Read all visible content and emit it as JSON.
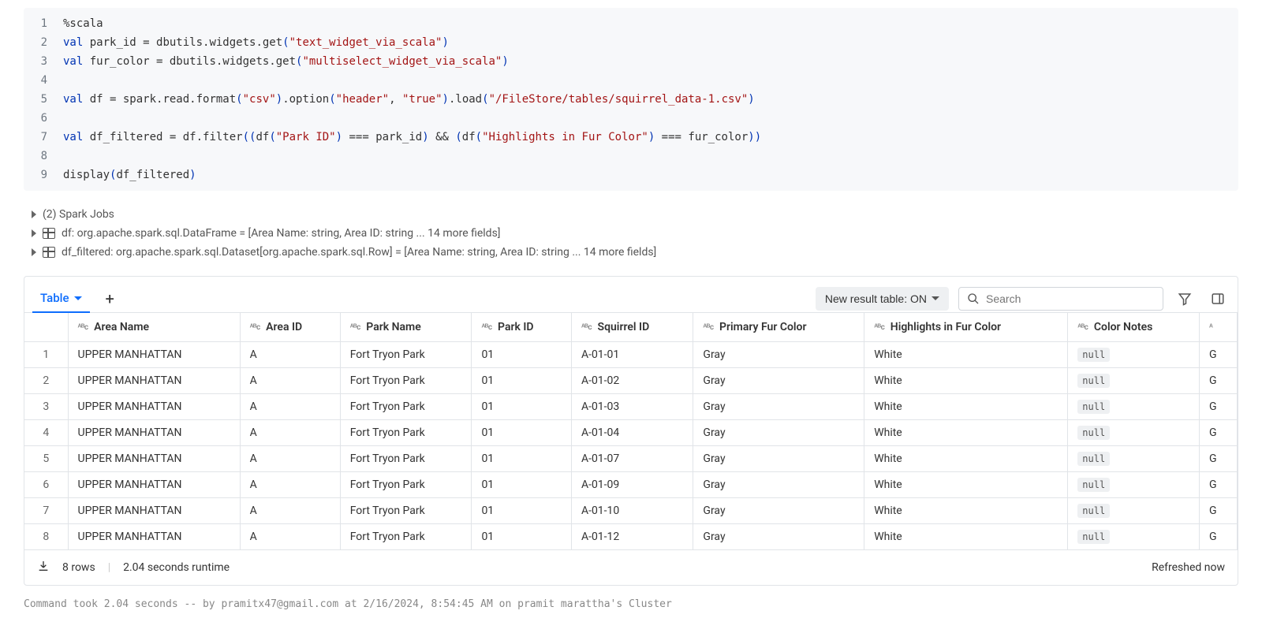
{
  "code": {
    "lines": [
      {
        "n": "1",
        "html": "<span class='tok-magic'>%scala</span>"
      },
      {
        "n": "2",
        "html": "<span class='tok-kw'>val</span> park_id = dbutils.widgets.get<span class='tok-paren'>(</span><span class='tok-str'>\"text_widget_via_scala\"</span><span class='tok-paren'>)</span>"
      },
      {
        "n": "3",
        "html": "<span class='tok-kw'>val</span> fur_color = dbutils.widgets.get<span class='tok-paren'>(</span><span class='tok-str'>\"multiselect_widget_via_scala\"</span><span class='tok-paren'>)</span>"
      },
      {
        "n": "4",
        "html": ""
      },
      {
        "n": "5",
        "html": "<span class='tok-kw'>val</span> df = spark.read.format<span class='tok-paren'>(</span><span class='tok-str'>\"csv\"</span><span class='tok-paren'>)</span>.option<span class='tok-paren'>(</span><span class='tok-str'>\"header\"</span>, <span class='tok-str'>\"true\"</span><span class='tok-paren'>)</span>.load<span class='tok-paren'>(</span><span class='tok-str'>\"/FileStore/tables/squirrel_data-1.csv\"</span><span class='tok-paren'>)</span>"
      },
      {
        "n": "6",
        "html": ""
      },
      {
        "n": "7",
        "html": "<span class='tok-kw'>val</span> df_filtered = df.filter<span class='tok-paren'>((</span>df<span class='tok-paren'>(</span><span class='tok-str'>\"Park ID\"</span><span class='tok-paren'>)</span> === park_id<span class='tok-paren'>)</span> &amp;&amp; <span class='tok-paren'>(</span>df<span class='tok-paren'>(</span><span class='tok-str'>\"Highlights in Fur Color\"</span><span class='tok-paren'>)</span> === fur_color<span class='tok-paren'>))</span>"
      },
      {
        "n": "8",
        "html": ""
      },
      {
        "n": "9",
        "html": "display<span class='tok-paren'>(</span>df_filtered<span class='tok-paren'>)</span>"
      }
    ]
  },
  "output": {
    "spark_jobs": "(2) Spark Jobs",
    "df_line": "df:  org.apache.spark.sql.DataFrame = [Area Name: string, Area ID: string ... 14 more fields]",
    "df_filtered_line": "df_filtered:  org.apache.spark.sql.Dataset[org.apache.spark.sql.Row] = [Area Name: string, Area ID: string ... 14 more fields]"
  },
  "toolbar": {
    "tab_label": "Table",
    "new_result_label": "New result table: ON",
    "search_placeholder": "Search"
  },
  "table": {
    "type_abc": "ᴬᴮc",
    "columns": [
      "Area Name",
      "Area ID",
      "Park Name",
      "Park ID",
      "Squirrel ID",
      "Primary Fur Color",
      "Highlights in Fur Color",
      "Color Notes"
    ],
    "rows": [
      {
        "n": "1",
        "area_name": "UPPER MANHATTAN",
        "area_id": "A",
        "park_name": "Fort Tryon Park",
        "park_id": "01",
        "squirrel_id": "A-01-01",
        "primary": "Gray",
        "highlights": "White",
        "notes": "null",
        "extra": "G"
      },
      {
        "n": "2",
        "area_name": "UPPER MANHATTAN",
        "area_id": "A",
        "park_name": "Fort Tryon Park",
        "park_id": "01",
        "squirrel_id": "A-01-02",
        "primary": "Gray",
        "highlights": "White",
        "notes": "null",
        "extra": "G"
      },
      {
        "n": "3",
        "area_name": "UPPER MANHATTAN",
        "area_id": "A",
        "park_name": "Fort Tryon Park",
        "park_id": "01",
        "squirrel_id": "A-01-03",
        "primary": "Gray",
        "highlights": "White",
        "notes": "null",
        "extra": "G"
      },
      {
        "n": "4",
        "area_name": "UPPER MANHATTAN",
        "area_id": "A",
        "park_name": "Fort Tryon Park",
        "park_id": "01",
        "squirrel_id": "A-01-04",
        "primary": "Gray",
        "highlights": "White",
        "notes": "null",
        "extra": "G"
      },
      {
        "n": "5",
        "area_name": "UPPER MANHATTAN",
        "area_id": "A",
        "park_name": "Fort Tryon Park",
        "park_id": "01",
        "squirrel_id": "A-01-07",
        "primary": "Gray",
        "highlights": "White",
        "notes": "null",
        "extra": "G"
      },
      {
        "n": "6",
        "area_name": "UPPER MANHATTAN",
        "area_id": "A",
        "park_name": "Fort Tryon Park",
        "park_id": "01",
        "squirrel_id": "A-01-09",
        "primary": "Gray",
        "highlights": "White",
        "notes": "null",
        "extra": "G"
      },
      {
        "n": "7",
        "area_name": "UPPER MANHATTAN",
        "area_id": "A",
        "park_name": "Fort Tryon Park",
        "park_id": "01",
        "squirrel_id": "A-01-10",
        "primary": "Gray",
        "highlights": "White",
        "notes": "null",
        "extra": "G"
      },
      {
        "n": "8",
        "area_name": "UPPER MANHATTAN",
        "area_id": "A",
        "park_name": "Fort Tryon Park",
        "park_id": "01",
        "squirrel_id": "A-01-12",
        "primary": "Gray",
        "highlights": "White",
        "notes": "null",
        "extra": "G"
      }
    ]
  },
  "footer": {
    "rows": "8 rows",
    "runtime": "2.04 seconds runtime",
    "refreshed": "Refreshed now"
  },
  "status": "Command took 2.04 seconds -- by pramitx47@gmail.com at 2/16/2024, 8:54:45 AM on pramit marattha's Cluster"
}
